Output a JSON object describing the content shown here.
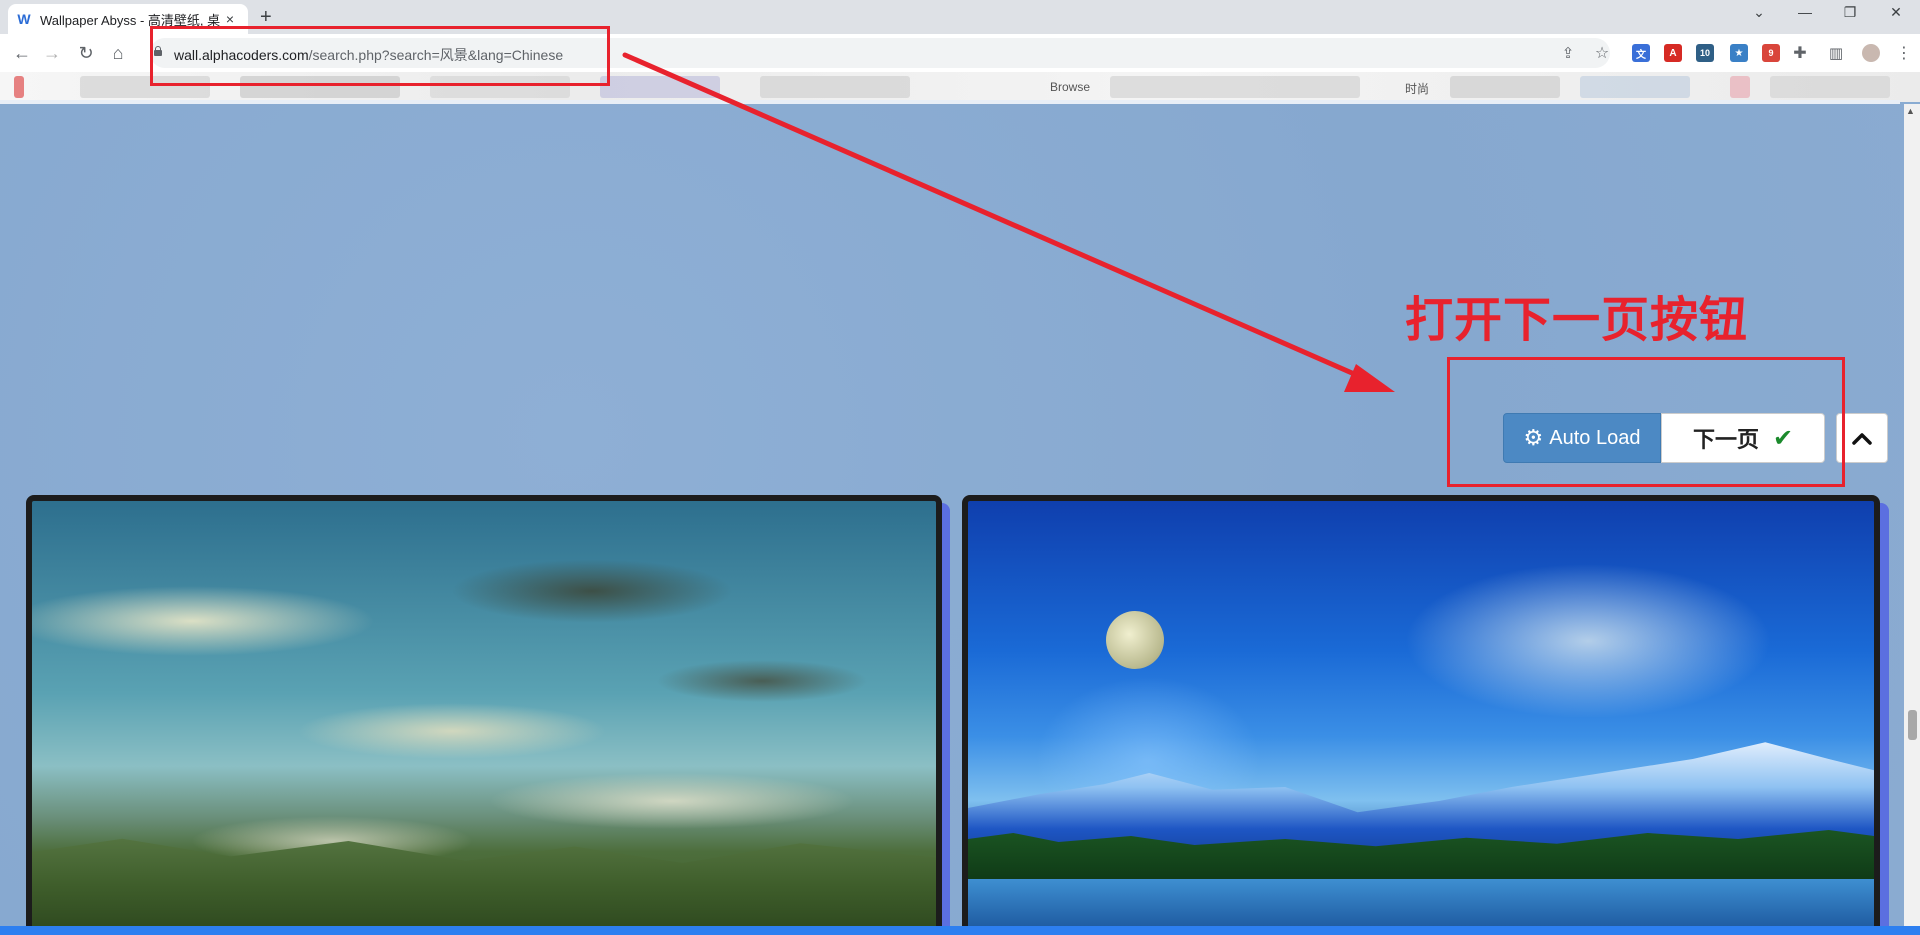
{
  "browser": {
    "tab_title": "Wallpaper Abyss - 高清壁纸, 桌",
    "tab_close": "×",
    "new_tab": "+",
    "url_host": "wall.alphacoders.com",
    "url_path": "/search.php?search=风景&lang=Chinese",
    "ext_badge_1": "10",
    "ext_badge_2": "9",
    "bookmark_text_1": "Browse",
    "bookmark_text_2": "时尚"
  },
  "annotation": {
    "label": "打开下一页按钮",
    "color": "#e8222d"
  },
  "controls": {
    "auto_load_label": "Auto Load",
    "next_page_label": "下一页",
    "gear_icon": "⚙",
    "check_icon": "✔"
  },
  "wallpapers": [
    {
      "name": "cloudy-sky-hills"
    },
    {
      "name": "moon-snow-mountains-lake"
    }
  ],
  "colors": {
    "page_background": "#8aacd2",
    "auto_load_button": "#4c89c4",
    "card_accent": "#5b6fe0"
  }
}
